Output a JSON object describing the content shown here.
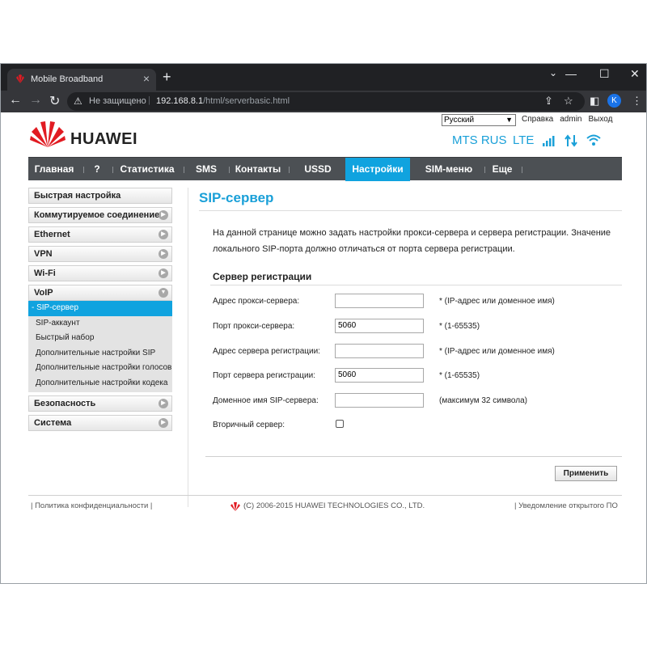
{
  "browser": {
    "tab_title": "Mobile Broadband",
    "insecure_label": "Не защищено",
    "url_host": "192.168.8.1",
    "url_path": "/html/serverbasic.html",
    "avatar_letter": "K"
  },
  "header": {
    "brand": "HUAWEI",
    "language": "Русский",
    "links": {
      "help": "Справка",
      "user": "admin",
      "logout": "Выход"
    },
    "operator": "MTS RUS",
    "network": "LTE"
  },
  "mainnav": [
    "Главная",
    "?",
    "Статистика",
    "SMS",
    "Контакты",
    "USSD",
    "Настройки",
    "SIM-меню",
    "Еще"
  ],
  "sidebar": {
    "items": [
      "Быстрая настройка",
      "Коммутируемое соединение",
      "Ethernet",
      "VPN",
      "Wi-Fi",
      "VoIP",
      "Безопасность",
      "Система"
    ],
    "voip_sub": [
      "- SIP-сервер",
      "SIP-аккаунт",
      "Быстрый набор",
      "Дополнительные настройки SIP",
      "Дополнительные настройки голосовых",
      "Дополнительные настройки кодека"
    ]
  },
  "content": {
    "title": "SIP-сервер",
    "description": "На данной странице можно задать настройки прокси-сервера и сервера регистрации. Значение локального SIP-порта должно отличаться от порта сервера регистрации.",
    "section": "Сервер регистрации",
    "fields": [
      {
        "label": "Адрес прокси-сервера:",
        "value": "",
        "hint": "* (IP-адрес или доменное имя)"
      },
      {
        "label": "Порт прокси-сервера:",
        "value": "5060",
        "hint": "* (1-65535)"
      },
      {
        "label": "Адрес сервера регистрации:",
        "value": "",
        "hint": "* (IP-адрес или доменное имя)"
      },
      {
        "label": "Порт сервера регистрации:",
        "value": "5060",
        "hint": "* (1-65535)"
      },
      {
        "label": "Доменное имя SIP-сервера:",
        "value": "",
        "hint": "(максимум 32 символа)"
      }
    ],
    "secondary_label": "Вторичный сервер:",
    "apply": "Применить"
  },
  "footer": {
    "privacy": "| Политика конфиденциальности |",
    "copyright": "(C) 2006-2015 HUAWEI TECHNOLOGIES CO., LTD.",
    "opensource": "| Уведомление открытого ПО"
  },
  "colors": {
    "accent": "#10a3df",
    "nav": "#4c5054"
  }
}
